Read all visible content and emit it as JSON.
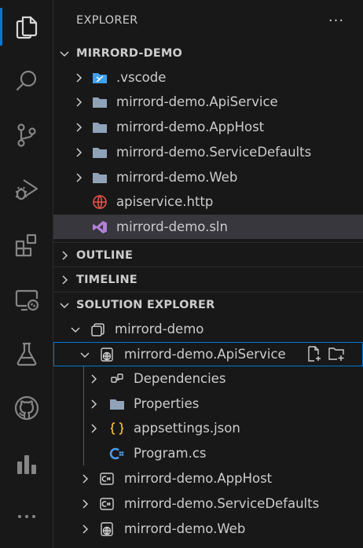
{
  "explorer": {
    "title": "EXPLORER",
    "more_label": "···"
  },
  "activity_bar": {
    "items": [
      {
        "icon": "files-icon"
      },
      {
        "icon": "search-icon"
      },
      {
        "icon": "source-control-icon"
      },
      {
        "icon": "run-debug-icon"
      },
      {
        "icon": "extensions-icon"
      },
      {
        "icon": "remote-explorer-icon"
      },
      {
        "icon": "testing-icon"
      },
      {
        "icon": "github-icon"
      },
      {
        "icon": "charts-icon"
      },
      {
        "icon": "more-icon"
      }
    ]
  },
  "workspace": {
    "name": "MIRRORD-DEMO",
    "items": [
      {
        "label": ".vscode",
        "icon": "vscode-folder-icon"
      },
      {
        "label": "mirrord-demo.ApiService",
        "icon": "folder-icon"
      },
      {
        "label": "mirrord-demo.AppHost",
        "icon": "folder-icon"
      },
      {
        "label": "mirrord-demo.ServiceDefaults",
        "icon": "folder-icon"
      },
      {
        "label": "mirrord-demo.Web",
        "icon": "folder-icon"
      },
      {
        "label": "apiservice.http",
        "icon": "globe-icon"
      },
      {
        "label": "mirrord-demo.sln",
        "icon": "visual-studio-icon"
      }
    ]
  },
  "sections": {
    "outline": "OUTLINE",
    "timeline": "TIMELINE",
    "solution_explorer": "SOLUTION EXPLORER"
  },
  "solution": {
    "name": "mirrord-demo",
    "api_service": {
      "label": "mirrord-demo.ApiService",
      "children": [
        {
          "label": "Dependencies",
          "icon": "dependencies-icon"
        },
        {
          "label": "Properties",
          "icon": "folder-icon"
        },
        {
          "label": "appsettings.json",
          "icon": "json-braces-icon"
        },
        {
          "label": "Program.cs",
          "icon": "csharp-icon"
        }
      ]
    },
    "projects": [
      {
        "label": "mirrord-demo.AppHost",
        "icon": "csharp-project-icon"
      },
      {
        "label": "mirrord-demo.ServiceDefaults",
        "icon": "csharp-project-icon"
      },
      {
        "label": "mirrord-demo.Web",
        "icon": "web-project-icon"
      }
    ]
  },
  "colors": {
    "accent": "#0078d4",
    "folder": "#8fa2b8",
    "vscode_blue": "#3ea0f0",
    "http_red": "#e8524a",
    "vs_purple": "#b180d7",
    "json_yellow": "#e8b63a",
    "csharp_blue": "#4b9ce8"
  }
}
